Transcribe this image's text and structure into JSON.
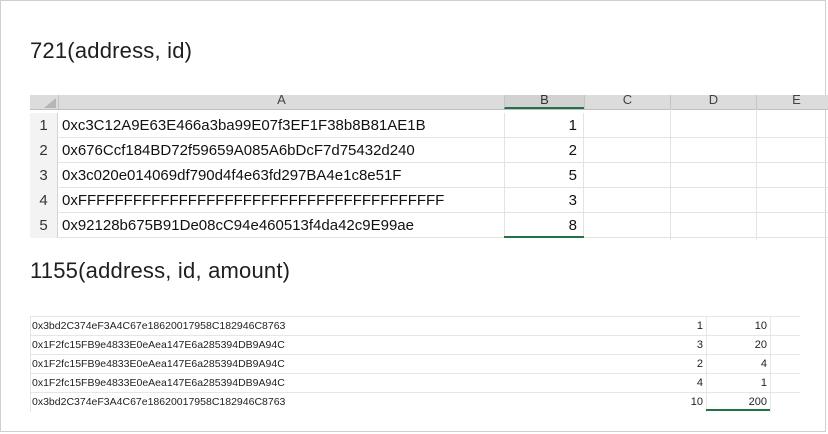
{
  "headings": {
    "first": "721(address, id)",
    "second": "1155(address, id, amount)"
  },
  "sheet1": {
    "columns": [
      "A",
      "B",
      "C",
      "D",
      "E"
    ],
    "rows": [
      {
        "num": "1",
        "address": "0xc3C12A9E63E466a3ba99E07f3EF1F38b8B81AE1B",
        "id": "1"
      },
      {
        "num": "2",
        "address": "0x676Ccf184BD72f59659A085A6bDcF7d75432d240",
        "id": "2"
      },
      {
        "num": "3",
        "address": "0x3c020e014069df790d4f4e63fd297BA4e1c8e51F",
        "id": "5"
      },
      {
        "num": "4",
        "address": "0xFFFFFFFFFFFFFFFFFFFFFFFFFFFFFFFFFFFFFFFF",
        "id": "3"
      },
      {
        "num": "5",
        "address": "0x92128b675B91De08cC94e460513f4da42c9E99ae",
        "id": "8"
      }
    ]
  },
  "sheet2": {
    "rows": [
      {
        "address": "0x3bd2C374eF3A4C67e18620017958C182946C8763",
        "id": "1",
        "amount": "10"
      },
      {
        "address": "0x1F2fc15FB9e4833E0eAea147E6a285394DB9A94C",
        "id": "3",
        "amount": "20"
      },
      {
        "address": "0x1F2fc15FB9e4833E0eAea147E6a285394DB9A94C",
        "id": "2",
        "amount": "4"
      },
      {
        "address": "0x1F2fc15FB9e4833E0eAea147E6a285394DB9A94C",
        "id": "4",
        "amount": "1"
      },
      {
        "address": "0x3bd2C374eF3A4C67e18620017958C182946C8763",
        "id": "10",
        "amount": "200"
      }
    ]
  }
}
